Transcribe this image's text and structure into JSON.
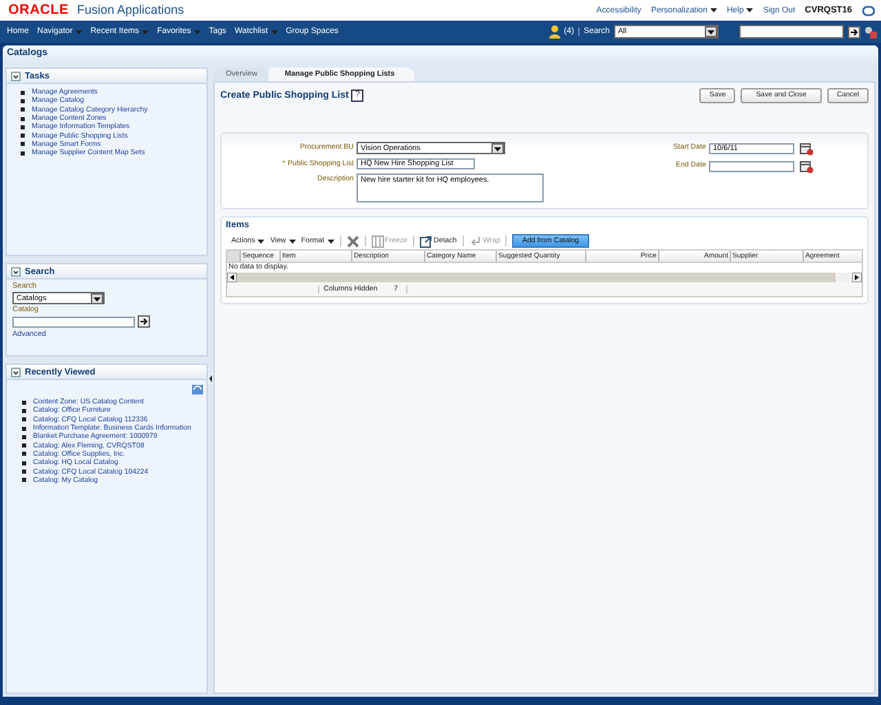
{
  "header": {
    "brand": "ORACLE",
    "app_name": "Fusion Applications",
    "links": [
      {
        "label": "Accessibility",
        "dropdown": false
      },
      {
        "label": "Personalization",
        "dropdown": true
      },
      {
        "label": "Help",
        "dropdown": true
      },
      {
        "label": "Sign Out",
        "dropdown": false
      }
    ],
    "user": "CVRQST16"
  },
  "navbar": {
    "items": [
      {
        "label": "Home",
        "dropdown": false
      },
      {
        "label": "Navigator",
        "dropdown": true
      },
      {
        "label": "Recent Items",
        "dropdown": true
      },
      {
        "label": "Favorites",
        "dropdown": true
      },
      {
        "label": "Tags",
        "dropdown": false
      },
      {
        "label": "Watchlist",
        "dropdown": true
      },
      {
        "label": "Group Spaces",
        "dropdown": false
      }
    ],
    "notifications": "(4)",
    "search_label": "Search",
    "search_scope": "All"
  },
  "page_title": "Catalogs",
  "sidebar": {
    "tasks": {
      "title": "Tasks",
      "items": [
        "Manage Agreements",
        "Manage Catalog",
        "Manage Catalog Category Hierarchy",
        "Manage Content Zones",
        "Manage Information Templates",
        "Manage Public Shopping Lists",
        "Manage Smart Forms",
        "Manage Supplier Content Map Sets"
      ]
    },
    "search": {
      "title": "Search",
      "search_label": "Search",
      "search_value": "Catalogs",
      "catalog_label": "Catalog",
      "advanced": "Advanced"
    },
    "recently_viewed": {
      "title": "Recently Viewed",
      "items": [
        "Content Zone: US Catalog Content",
        "Catalog: Office Furniture",
        "Catalog: CFQ Local Catalog 112336",
        "Information Template: Business Cards Information",
        "Blanket Purchase Agreement: 1000979",
        "Catalog: Alex Fleming, CVRQST08",
        "Catalog: Office Supplies, Inc.",
        "Catalog: HQ Local Catalog",
        "Catalog: CFQ Local Catalog 104224",
        "Catalog: My Catalog"
      ]
    }
  },
  "tabs": [
    {
      "label": "Overview",
      "selected": false
    },
    {
      "label": "Manage Public Shopping Lists",
      "selected": true
    }
  ],
  "form": {
    "title": "Create Public Shopping List",
    "help": "?",
    "required_marker": "*",
    "buttons": [
      "Save",
      "Save and Close",
      "Cancel"
    ],
    "fields_left": [
      {
        "kind": "select",
        "label": "Procurement BU",
        "value": "Vision Operations",
        "required": false
      },
      {
        "kind": "text",
        "label": "Public Shopping List",
        "value": "HQ New Hire Shopping List",
        "required": true
      },
      {
        "kind": "textarea",
        "label": "Description",
        "value": "New hire starter kit for HQ employees.",
        "required": false
      }
    ],
    "fields_right": [
      {
        "kind": "date",
        "label": "Start Date",
        "value": "10/6/11"
      },
      {
        "kind": "date",
        "label": "End Date"
      }
    ]
  },
  "items": {
    "title": "Items",
    "menus": [
      "Actions",
      "View",
      "Format"
    ],
    "tools": [
      {
        "kind": "delete",
        "disabled": false
      },
      {
        "kind": "freeze",
        "label": "Freeze",
        "disabled": true
      },
      {
        "kind": "detach",
        "label": "Detach",
        "disabled": false
      },
      {
        "kind": "wrap",
        "label": "Wrap",
        "disabled": true
      },
      {
        "kind": "primary",
        "label": "Add from Catalog",
        "disabled": false
      }
    ],
    "columns": [
      {
        "label": "Sequence",
        "kind": "text"
      },
      {
        "label": "Item",
        "kind": "text"
      },
      {
        "label": "Description",
        "kind": "text"
      },
      {
        "label": "Category Name",
        "kind": "text"
      },
      {
        "label": "Suggested Quantity",
        "kind": "text"
      },
      {
        "label": "Price",
        "kind": "number"
      },
      {
        "label": "Amount",
        "kind": "number"
      },
      {
        "label": "Supplier",
        "kind": "text"
      },
      {
        "label": "Agreement",
        "kind": "text"
      }
    ],
    "empty_message": "No data to display.",
    "columns_hidden_label": "Columns Hidden",
    "columns_hidden_count": "7"
  }
}
